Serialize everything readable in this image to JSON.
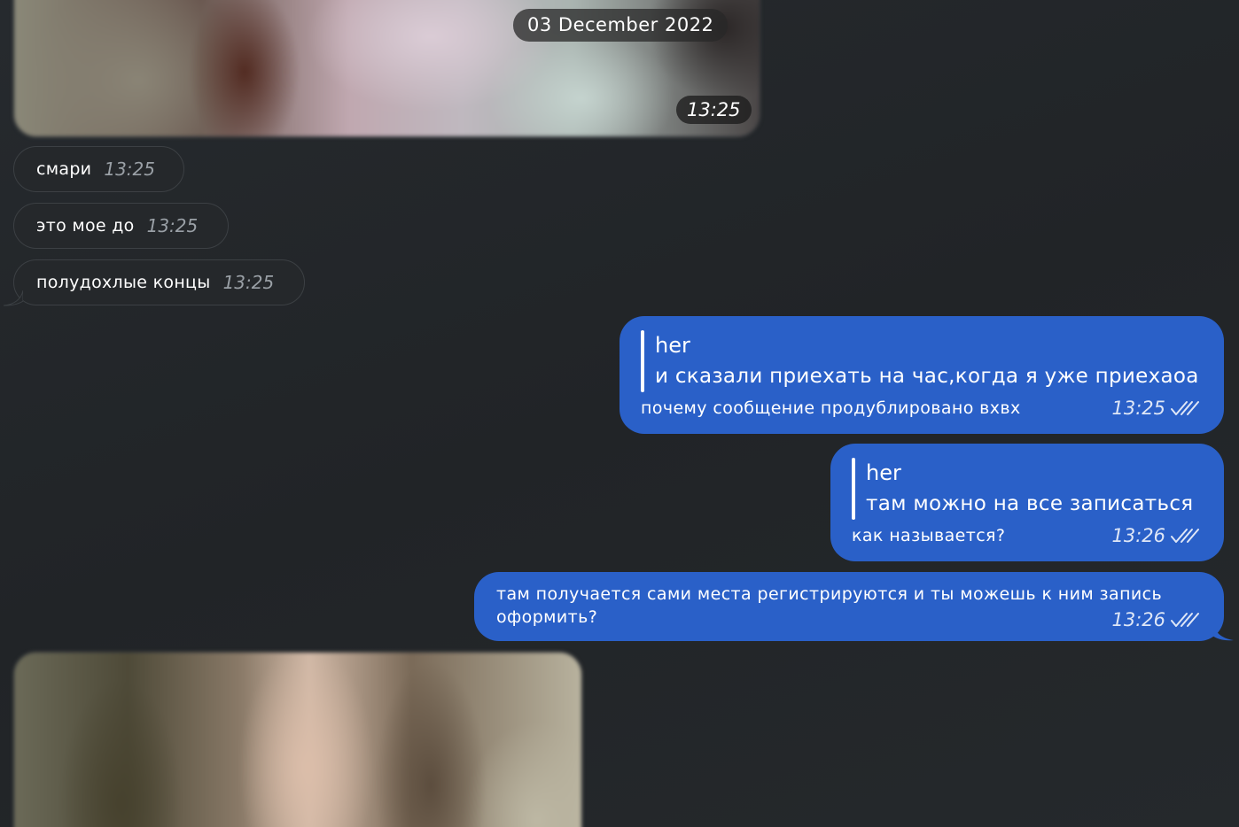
{
  "top_media": {
    "date_label": "03 December 2022",
    "time": "13:25"
  },
  "incoming": [
    {
      "text": "смари",
      "time": "13:25"
    },
    {
      "text": "это мое до",
      "time": "13:25"
    },
    {
      "text": "полудохлые концы",
      "time": "13:25"
    }
  ],
  "outgoing": [
    {
      "reply_name": "her",
      "reply_text": "и сказали приехать на час,когда я уже приехаоа",
      "text": "почему сообщение продублировано вхвх",
      "time": "13:25",
      "status": "read"
    },
    {
      "reply_name": "her",
      "reply_text": "там можно на все записаться",
      "text": "как называется?",
      "time": "13:26",
      "status": "read"
    },
    {
      "text": "там получается сами места регистрируются и ты можешь к ним запись оформить?",
      "time": "13:26",
      "status": "read"
    }
  ],
  "colors": {
    "background": "#232629",
    "outgoing_bubble": "#2a60c8",
    "incoming_bubble": "#25282b"
  },
  "icons": {
    "read_status": "double-check-icon"
  }
}
